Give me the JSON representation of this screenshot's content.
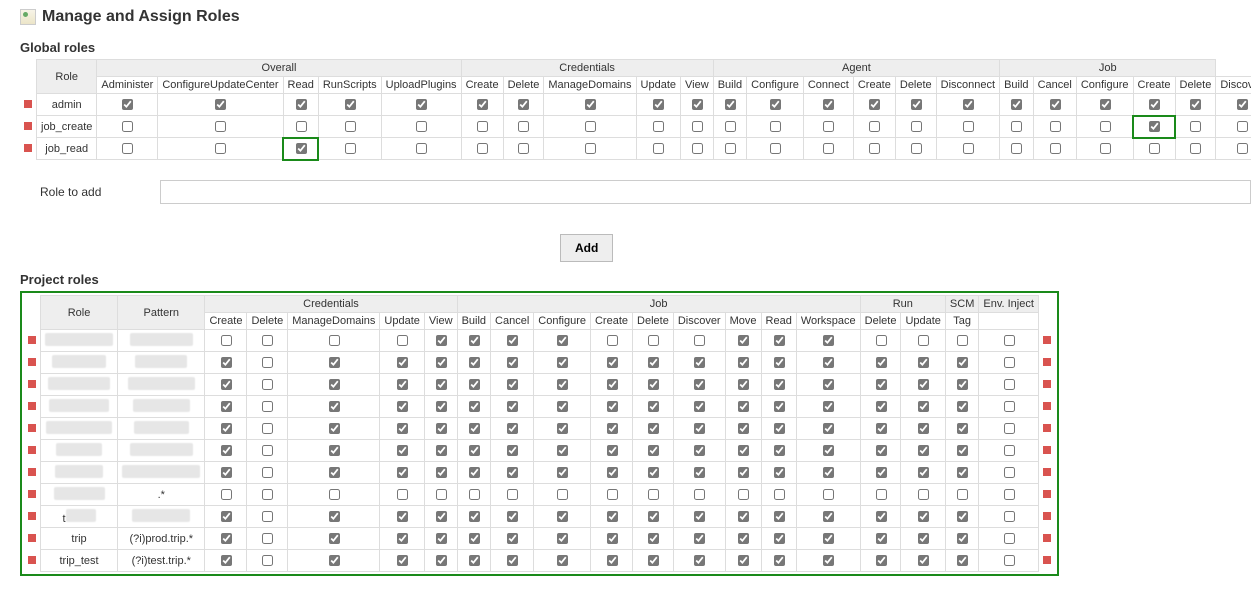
{
  "title": "Manage and Assign Roles",
  "sections": {
    "global": "Global roles",
    "project": "Project roles"
  },
  "roleToAdd": {
    "label": "Role to add",
    "value": "",
    "button": "Add"
  },
  "global_table": {
    "role_header": "Role",
    "groups": [
      {
        "label": "Overall",
        "span": 5
      },
      {
        "label": "Credentials",
        "span": 5
      },
      {
        "label": "Agent",
        "span": 6
      },
      {
        "label": "Job",
        "span": 5
      }
    ],
    "cols": [
      "Administer",
      "ConfigureUpdateCenter",
      "Read",
      "RunScripts",
      "UploadPlugins",
      "Create",
      "Delete",
      "ManageDomains",
      "Update",
      "View",
      "Build",
      "Configure",
      "Connect",
      "Create",
      "Delete",
      "Disconnect",
      "Build",
      "Cancel",
      "Configure",
      "Create",
      "Delete",
      "Discover"
    ],
    "highlight_cells": [
      "job_read/2",
      "job_create/19"
    ],
    "rows": [
      {
        "name": "admin",
        "checks": [
          true,
          true,
          true,
          true,
          true,
          true,
          true,
          true,
          true,
          true,
          true,
          true,
          true,
          true,
          true,
          true,
          true,
          true,
          true,
          true,
          true,
          true
        ]
      },
      {
        "name": "job_create",
        "checks": [
          false,
          false,
          false,
          false,
          false,
          false,
          false,
          false,
          false,
          false,
          false,
          false,
          false,
          false,
          false,
          false,
          false,
          false,
          false,
          true,
          false,
          false
        ]
      },
      {
        "name": "job_read",
        "checks": [
          false,
          false,
          true,
          false,
          false,
          false,
          false,
          false,
          false,
          false,
          false,
          false,
          false,
          false,
          false,
          false,
          false,
          false,
          false,
          false,
          false,
          false
        ]
      }
    ]
  },
  "project_table": {
    "role_header": "Role",
    "pattern_header": "Pattern",
    "groups": [
      {
        "label": "Credentials",
        "span": 5
      },
      {
        "label": "Job",
        "span": 9
      },
      {
        "label": "Run",
        "span": 2
      },
      {
        "label": "SCM",
        "span": 1
      },
      {
        "label": "Env. Inject",
        "span": 1
      }
    ],
    "cols": [
      "Create",
      "Delete",
      "ManageDomains",
      "Update",
      "View",
      "Build",
      "Cancel",
      "Configure",
      "Create",
      "Delete",
      "Discover",
      "Move",
      "Read",
      "Workspace",
      "Delete",
      "Update",
      "Tag",
      ""
    ],
    "rows": [
      {
        "name": "_redacted",
        "pattern": "_redacted",
        "checks": [
          false,
          false,
          false,
          false,
          true,
          true,
          true,
          true,
          false,
          false,
          false,
          true,
          true,
          true,
          false,
          false,
          false,
          false
        ]
      },
      {
        "name": "_redacted",
        "pattern": "_redacted",
        "checks": [
          true,
          false,
          true,
          true,
          true,
          true,
          true,
          true,
          true,
          true,
          true,
          true,
          true,
          true,
          true,
          true,
          true,
          false
        ]
      },
      {
        "name": "_redacted",
        "pattern": "_redacted",
        "checks": [
          true,
          false,
          true,
          true,
          true,
          true,
          true,
          true,
          true,
          true,
          true,
          true,
          true,
          true,
          true,
          true,
          true,
          false
        ]
      },
      {
        "name": "_redacted",
        "pattern": "_redacted",
        "checks": [
          true,
          false,
          true,
          true,
          true,
          true,
          true,
          true,
          true,
          true,
          true,
          true,
          true,
          true,
          true,
          true,
          true,
          false
        ]
      },
      {
        "name": "_redacted",
        "pattern": "_redacted",
        "checks": [
          true,
          false,
          true,
          true,
          true,
          true,
          true,
          true,
          true,
          true,
          true,
          true,
          true,
          true,
          true,
          true,
          true,
          false
        ]
      },
      {
        "name": "_redacted",
        "pattern": "_redacted",
        "checks": [
          true,
          false,
          true,
          true,
          true,
          true,
          true,
          true,
          true,
          true,
          true,
          true,
          true,
          true,
          true,
          true,
          true,
          false
        ]
      },
      {
        "name": "_redacted",
        "pattern": "_redacted",
        "checks": [
          true,
          false,
          true,
          true,
          true,
          true,
          true,
          true,
          true,
          true,
          true,
          true,
          true,
          true,
          true,
          true,
          true,
          false
        ]
      },
      {
        "name": "_redacted",
        "pattern": ".*",
        "checks": [
          false,
          false,
          false,
          false,
          false,
          false,
          false,
          false,
          false,
          false,
          false,
          false,
          false,
          false,
          false,
          false,
          false,
          false
        ]
      },
      {
        "name": "t_redacted",
        "pattern": "_redacted",
        "checks": [
          true,
          false,
          true,
          true,
          true,
          true,
          true,
          true,
          true,
          true,
          true,
          true,
          true,
          true,
          true,
          true,
          true,
          false
        ]
      },
      {
        "name": "trip",
        "pattern": "(?i)prod.trip.*",
        "checks": [
          true,
          false,
          true,
          true,
          true,
          true,
          true,
          true,
          true,
          true,
          true,
          true,
          true,
          true,
          true,
          true,
          true,
          false
        ]
      },
      {
        "name": "trip_test",
        "pattern": "(?i)test.trip.*",
        "checks": [
          true,
          false,
          true,
          true,
          true,
          true,
          true,
          true,
          true,
          true,
          true,
          true,
          true,
          true,
          true,
          true,
          true,
          false
        ]
      }
    ]
  }
}
